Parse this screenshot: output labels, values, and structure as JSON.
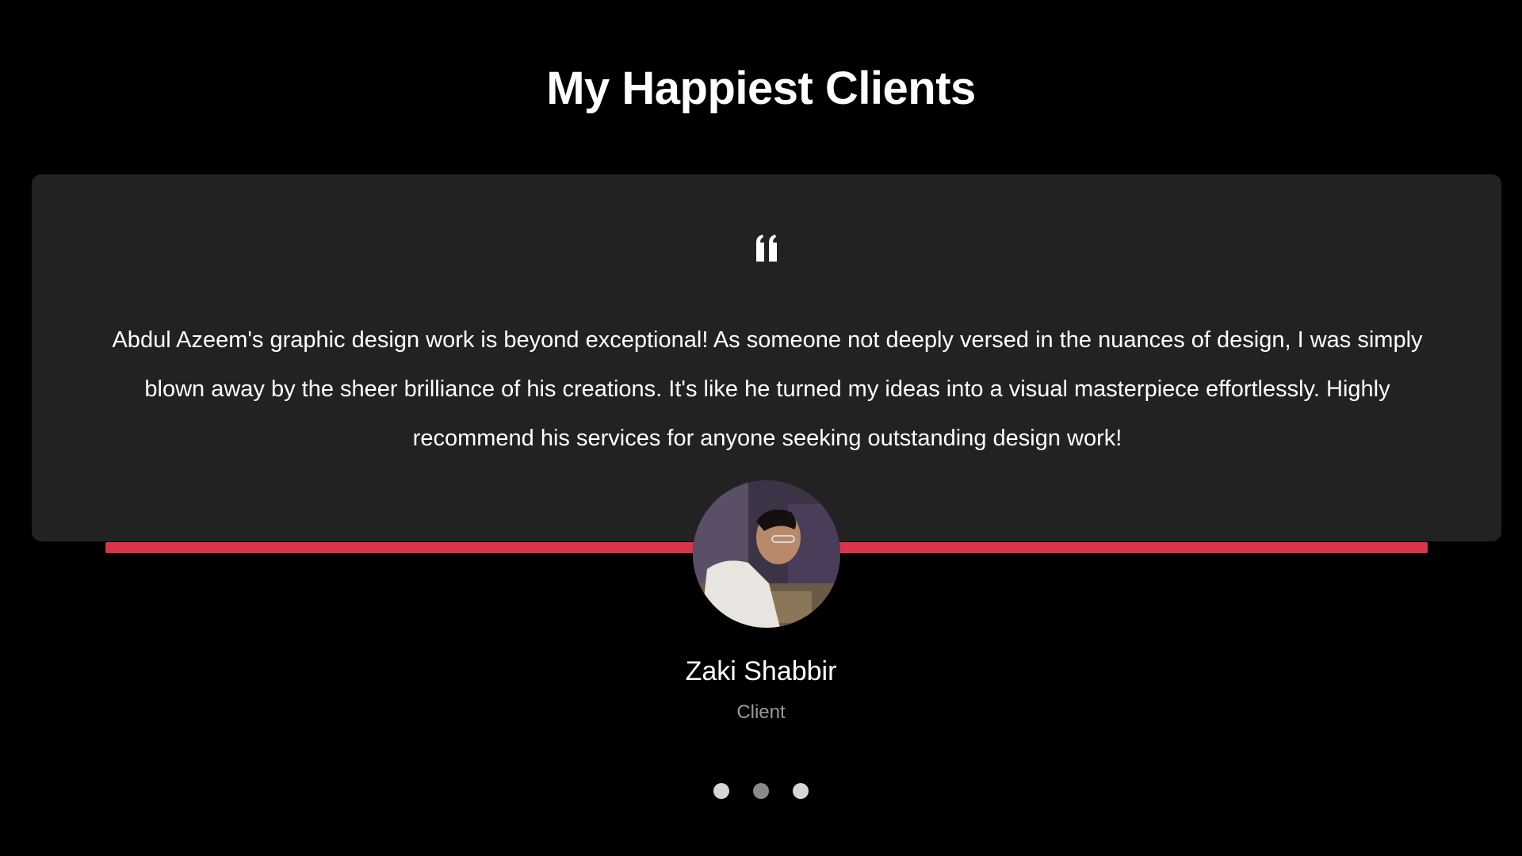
{
  "section": {
    "title": "My Happiest Clients"
  },
  "testimonial": {
    "quote_icon": "quote-left-icon",
    "text": "Abdul Azeem's graphic design work is beyond exceptional! As someone not deeply versed in the nuances of design, I was simply blown away by the sheer brilliance of his creations. It's like he turned my ideas into a visual masterpiece effortlessly. Highly recommend his services for anyone seeking outstanding design work!",
    "client_name": "Zaki Shabbir",
    "client_role": "Client",
    "avatar_icon": "client-avatar-photo"
  },
  "carousel": {
    "dot_count": 3,
    "active_index": 1
  },
  "colors": {
    "background": "#000000",
    "card": "#222222",
    "accent": "#d93448",
    "text": "#ffffff",
    "muted": "#9a9a9a"
  }
}
